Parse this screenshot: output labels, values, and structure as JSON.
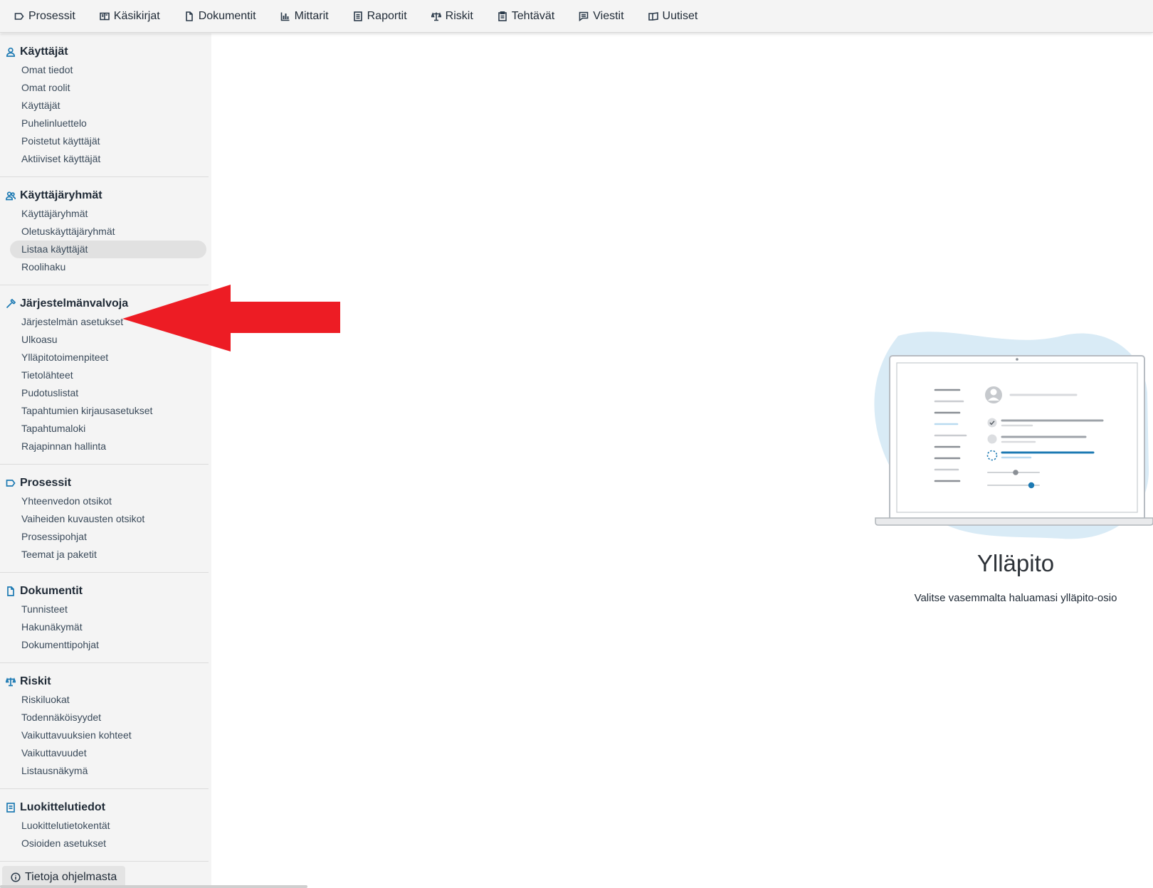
{
  "topnav": {
    "items": [
      {
        "label": "Prosessit",
        "icon": "tag-icon"
      },
      {
        "label": "Käsikirjat",
        "icon": "book-icon"
      },
      {
        "label": "Dokumentit",
        "icon": "document-icon"
      },
      {
        "label": "Mittarit",
        "icon": "bar-chart-icon"
      },
      {
        "label": "Raportit",
        "icon": "report-icon"
      },
      {
        "label": "Riskit",
        "icon": "scale-icon"
      },
      {
        "label": "Tehtävät",
        "icon": "clipboard-icon"
      },
      {
        "label": "Viestit",
        "icon": "message-icon"
      },
      {
        "label": "Uutiset",
        "icon": "news-icon"
      }
    ]
  },
  "sidebar": {
    "sections": [
      {
        "title": "Käyttäjät",
        "icon": "user-icon",
        "items": [
          "Omat tiedot",
          "Omat roolit",
          "Käyttäjät",
          "Puhelinluettelo",
          "Poistetut käyttäjät",
          "Aktiiviset käyttäjät"
        ]
      },
      {
        "title": "Käyttäjäryhmät",
        "icon": "users-icon",
        "items": [
          "Käyttäjäryhmät",
          "Oletuskäyttäjäryhmät",
          "Listaa käyttäjät",
          "Roolihaku"
        ]
      },
      {
        "title": "Järjestelmänvalvoja",
        "icon": "hammer-icon",
        "items": [
          "Järjestelmän asetukset",
          "Ulkoasu",
          "Ylläpitotoimenpiteet",
          "Tietolähteet",
          "Pudotuslistat",
          "Tapahtumien kirjausasetukset",
          "Tapahtumaloki",
          "Rajapinnan hallinta"
        ]
      },
      {
        "title": "Prosessit",
        "icon": "tag-icon",
        "items": [
          "Yhteenvedon otsikot",
          "Vaiheiden kuvausten otsikot",
          "Prosessipohjat",
          "Teemat ja paketit"
        ]
      },
      {
        "title": "Dokumentit",
        "icon": "document-icon",
        "items": [
          "Tunnisteet",
          "Hakunäkymät",
          "Dokumenttipohjat"
        ]
      },
      {
        "title": "Riskit",
        "icon": "scale-icon",
        "items": [
          "Riskiluokat",
          "Todennäköisyydet",
          "Vaikuttavuuksien kohteet",
          "Vaikuttavuudet",
          "Listausnäkymä"
        ]
      },
      {
        "title": "Luokittelutiedot",
        "icon": "list-icon",
        "items": [
          "Luokittelutietokentät",
          "Osioiden asetukset"
        ]
      }
    ],
    "active_item": "Listaa käyttäjät",
    "about_label": "Tietoja ohjelmasta"
  },
  "main": {
    "title": "Ylläpito",
    "subtitle": "Valitse vasemmalta haluamasi ylläpito-osio"
  },
  "colors": {
    "accent": "#1d7ab3",
    "arrow": "#ed1c24",
    "sidebar_bg": "#f4f4f4"
  }
}
